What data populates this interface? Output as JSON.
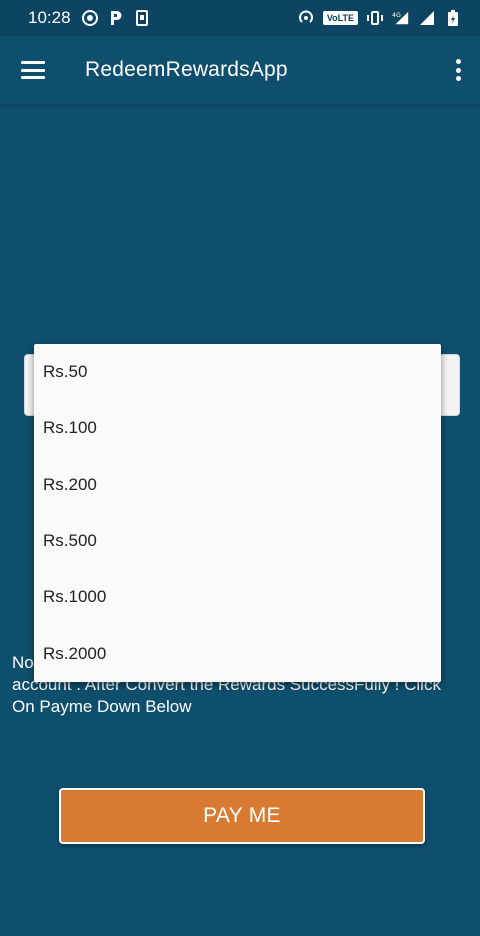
{
  "status_bar": {
    "time": "10:28",
    "left_icons": [
      "whatsapp-icon",
      "paytm-icon",
      "phone-icon"
    ],
    "right_icons": [
      "hotspot-icon",
      "volte-icon",
      "vibrate-icon",
      "signal-4g-icon",
      "signal-icon",
      "battery-icon"
    ],
    "volte_label": "VoLTE",
    "network_label": "4G"
  },
  "app_bar": {
    "title": "RedeemRewardsApp"
  },
  "note": {
    "text": "Note: After Converting Rewards will be credited into your account . After Convert the Rewards SuccessFully ! Click On Payme Down Below"
  },
  "pay_button": {
    "label": "PAY ME",
    "color": "#d97a33"
  },
  "dropdown": {
    "options": [
      "Rs.50",
      "Rs.100",
      "Rs.200",
      "Rs.500",
      "Rs.1000",
      "Rs.2000"
    ]
  },
  "colors": {
    "background": "#0f4f6e",
    "status_bar": "#0c4462",
    "accent": "#d97a33"
  }
}
